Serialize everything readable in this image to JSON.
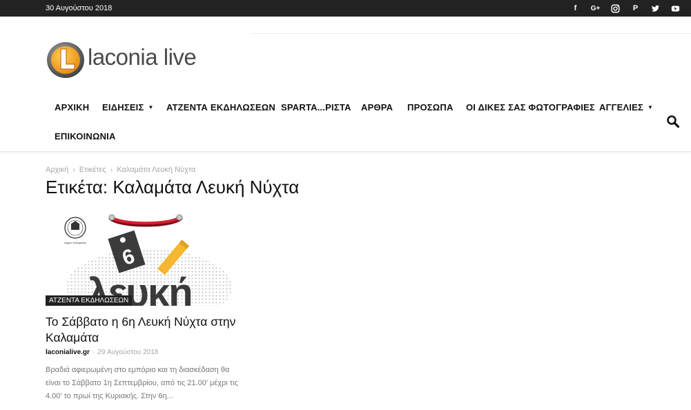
{
  "topbar": {
    "date": "30 Αυγούστου 2018",
    "social": [
      {
        "icon": "facebook-icon",
        "glyph": "f"
      },
      {
        "icon": "google-plus-icon",
        "glyph": "G+"
      },
      {
        "icon": "instagram-icon",
        "glyph": ""
      },
      {
        "icon": "pinterest-icon",
        "glyph": "P"
      },
      {
        "icon": "twitter-icon",
        "glyph": ""
      },
      {
        "icon": "youtube-icon",
        "glyph": ""
      }
    ]
  },
  "logo": {
    "text_main": "laconia",
    "text_second": "live",
    "letter": "L",
    "colors": {
      "ring": "#6d6d6d",
      "disc": "#f5a623",
      "letter": "#ffffff"
    }
  },
  "nav": {
    "items": [
      {
        "label": "ΑΡΧΙΚΗ",
        "dropdown": false
      },
      {
        "label": "ΕΙΔΗΣΕΙΣ",
        "dropdown": true
      },
      {
        "label": "ΑΤΖΕΝΤΑ ΕΚΔΗΛΩΣΕΩΝ",
        "dropdown": false
      },
      {
        "label": "SPARTA...ΡΙΣΤΑ",
        "dropdown": false
      },
      {
        "label": "ΑΡΘΡΑ",
        "dropdown": false
      },
      {
        "label": "ΠΡΟΣΩΠΑ",
        "dropdown": false
      },
      {
        "label": "ΟΙ ΔΙΚΕΣ ΣΑΣ ΦΩΤΟΓΡΑΦΙΕΣ",
        "dropdown": false
      },
      {
        "label": "ΑΓΓΕΛΙΕΣ",
        "dropdown": true
      },
      {
        "label": "ΕΠΙΚΟΙΝΩΝΙΑ",
        "dropdown": false
      }
    ],
    "search_icon": "search-icon"
  },
  "breadcrumb": {
    "items": [
      "Αρχική",
      "Ετικέτες",
      "Καλαμάτα Λευκή Νύχτα"
    ],
    "separator": "›"
  },
  "page": {
    "title": "Ετικέτα: Καλαμάτα Λευκή Νύχτα"
  },
  "article": {
    "category": "ΑΤΖΕΝΤΑ ΕΚΔΗΛΩΣΕΩΝ",
    "title": "Το Σάββατο η 6η Λευκή Νύχτα στην Καλαμάτα",
    "author": "laconialive.gr",
    "separator": "-",
    "date": "29 Αυγούστου 2018",
    "excerpt": "Βραδιά αφιερωμένη στο εμπόριο και τη διασκέδαση θα είναι το Σάββατο 1η Σεπτεμβρίου, από τις 21.00' μέχρι τις 4.00' το πρωί της Κυριακής. Στην 6η...",
    "image": {
      "tag_text": "6",
      "big_text": "λευκή",
      "seal_text": "ΕΜΠΟΡΙΚΟΣ ΣΥΛΛΟΓΟΣ ΚΑΛΑΜΑΤΑΣ",
      "seal_year": "1903",
      "seal_caption": "Δήμος Καλαμάτας",
      "colors": {
        "cord": "#c8102e",
        "tag": "#3a3a3a",
        "pencil": "#f5b731"
      }
    }
  }
}
